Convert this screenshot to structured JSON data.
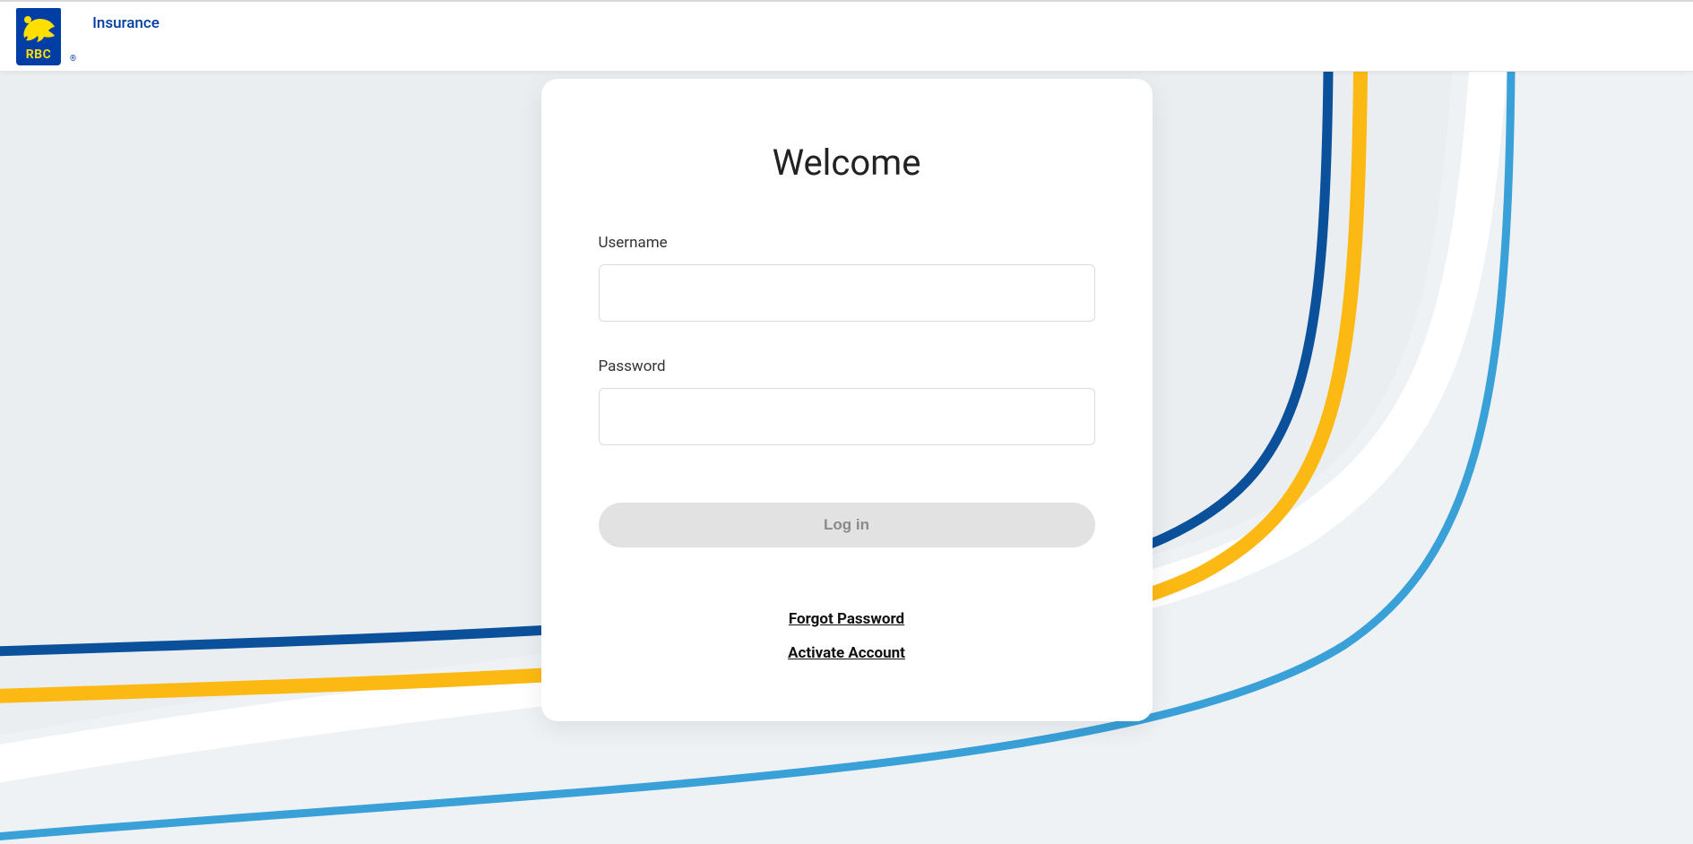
{
  "header": {
    "logo_text": "RBC",
    "brand_sub": "Insurance"
  },
  "card": {
    "title": "Welcome",
    "username_label": "Username",
    "password_label": "Password",
    "login_button": "Log in",
    "forgot_password": "Forgot Password",
    "activate_account": "Activate Account"
  },
  "colors": {
    "brand_blue": "#003da5",
    "brand_yellow": "#fedf01",
    "sky_blue": "#39a0d8",
    "page_bg": "#eaeef1"
  }
}
